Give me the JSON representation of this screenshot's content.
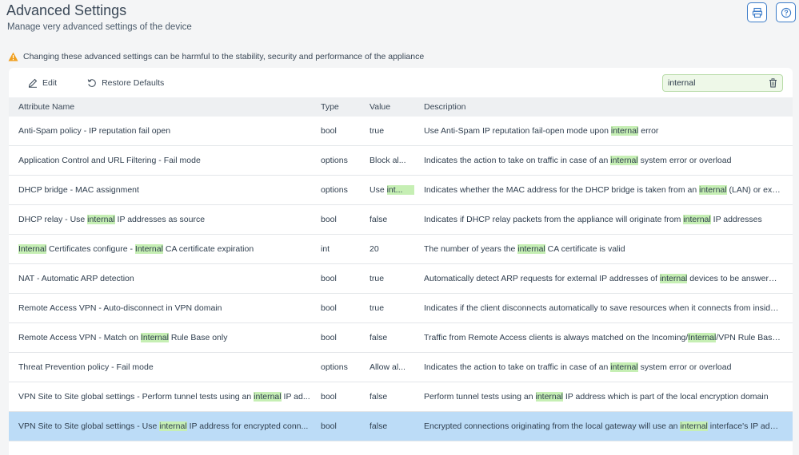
{
  "header": {
    "title": "Advanced Settings",
    "subtitle": "Manage very advanced settings of the device",
    "print_icon": "printer-icon",
    "help_icon": "help-icon"
  },
  "warning": {
    "icon": "warning-triangle-icon",
    "text": "Changing these advanced settings can be harmful to the stability, security and performance of the appliance",
    "color": "#f0a020"
  },
  "toolbar": {
    "edit_label": "Edit",
    "restore_label": "Restore Defaults",
    "search_value": "internal"
  },
  "table": {
    "columns": [
      "Attribute Name",
      "Type",
      "Value",
      "Description"
    ],
    "rows": [
      {
        "name": "Anti-Spam policy - IP reputation fail open",
        "type": "bool",
        "value": "true",
        "description": "Use Anti-Spam IP reputation fail-open mode upon internal error"
      },
      {
        "name": "Application Control and URL Filtering - Fail mode",
        "type": "options",
        "value": "Block al...",
        "description": "Indicates the action to take on traffic in case of an internal system error or overload"
      },
      {
        "name": "DHCP bridge - MAC assignment",
        "type": "options",
        "value": "Use int...",
        "description": "Indicates whether the MAC address for the DHCP bridge is taken from an internal (LAN) or exter..."
      },
      {
        "name": "DHCP relay - Use internal IP addresses as source",
        "type": "bool",
        "value": "false",
        "description": "Indicates if DHCP relay packets from the appliance will originate from internal IP addresses"
      },
      {
        "name": "Internal Certificates configure - Internal CA certificate expiration",
        "type": "int",
        "value": "20",
        "description": "The number of years the internal CA certificate is valid"
      },
      {
        "name": "NAT - Automatic ARP detection",
        "type": "bool",
        "value": "true",
        "description": "Automatically detect ARP requests for external IP addresses of internal devices to be answered ..."
      },
      {
        "name": "Remote Access VPN - Auto-disconnect in VPN domain",
        "type": "bool",
        "value": "true",
        "description": "Indicates if the client disconnects automatically to save resources when it connects from inside t..."
      },
      {
        "name": "Remote Access VPN - Match on Internal Rule Base only",
        "type": "bool",
        "value": "false",
        "description": "Traffic from Remote Access clients is always matched on the Incoming/Internal/VPN Rule Base, i..."
      },
      {
        "name": "Threat Prevention policy - Fail mode",
        "type": "options",
        "value": "Allow al...",
        "description": "Indicates the action to take on traffic in case of an internal system error or overload"
      },
      {
        "name": "VPN Site to Site global settings - Perform tunnel tests using an internal IP ad...",
        "type": "bool",
        "value": "false",
        "description": "Perform tunnel tests using an internal IP address which is part of the local encryption domain"
      },
      {
        "name": "VPN Site to Site global settings - Use internal IP address for encrypted conn...",
        "type": "bool",
        "value": "false",
        "description": "Encrypted connections originating from the local gateway will use an internal interface's IP addr...",
        "selected": true
      }
    ]
  },
  "colors": {
    "accent": "#3b7bc8",
    "highlight": "#c6efb4",
    "selected_row": "#bcdcf7"
  }
}
